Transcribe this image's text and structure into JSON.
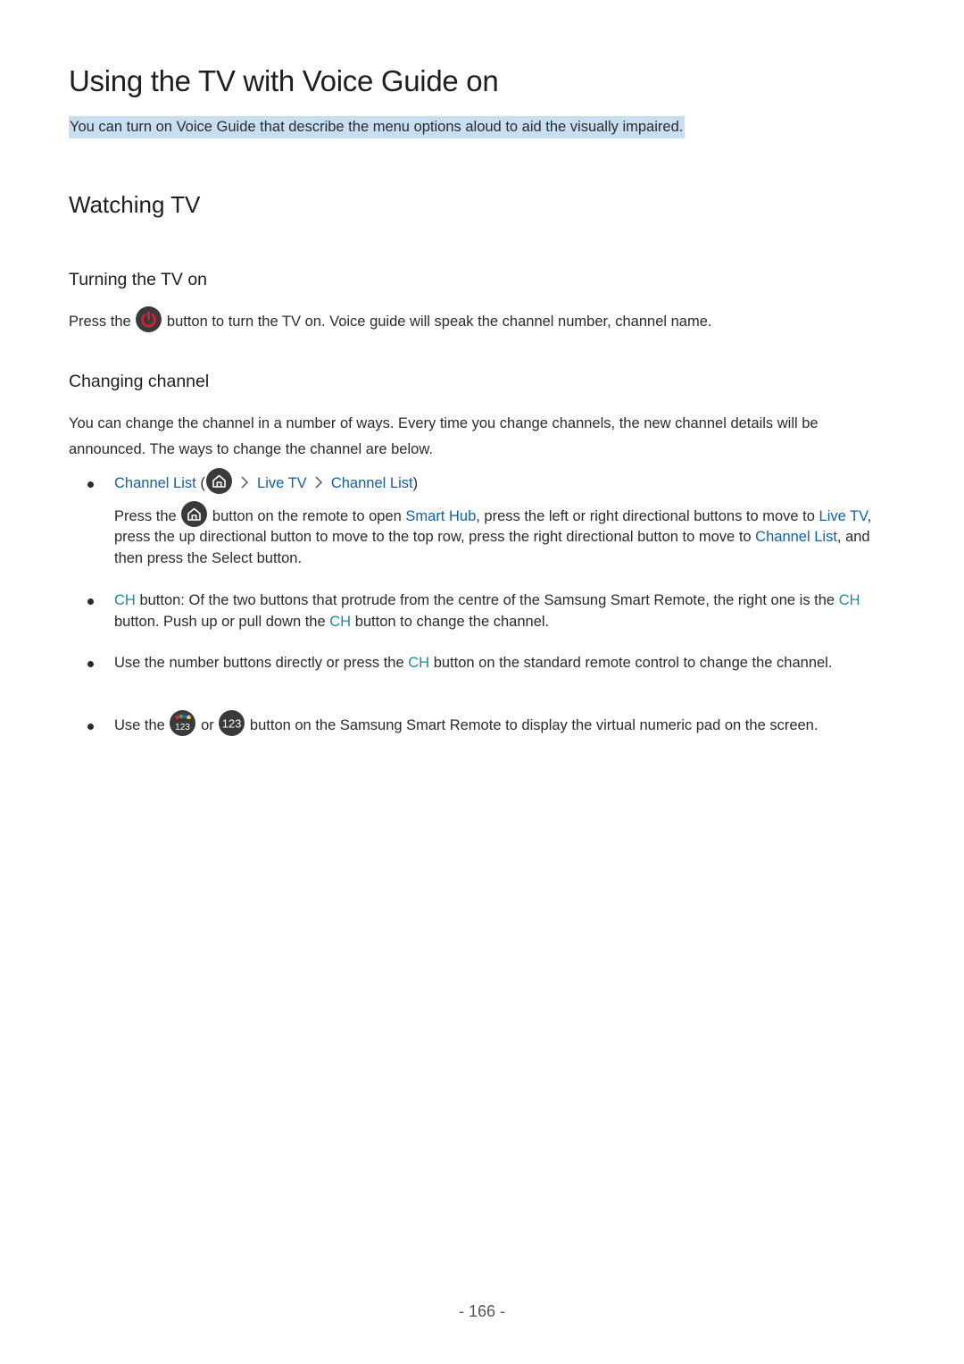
{
  "document": {
    "title": "Using the TV with Voice Guide on",
    "intro": "You can turn on Voice Guide that describe the menu options aloud to aid the visually impaired.",
    "section_heading": "Watching TV",
    "turning_on": {
      "heading": "Turning the TV on",
      "text_before_icon": "Press the",
      "icon": "power-icon",
      "text_after_icon": "button to turn the TV on. Voice guide will speak the channel number, channel name."
    },
    "changing_channel": {
      "heading": "Changing channel",
      "intro": "You can change the channel in a number of ways. Every time you change channels, the new channel details will be announced. The ways to change the channel are below.",
      "bullets": [
        {
          "menu_path": {
            "item1": "Channel List",
            "open_paren": "(",
            "icon": "home-icon",
            "item2": "Live TV",
            "item3": "Channel List",
            "close_paren": ")"
          },
          "body": {
            "t1": "Press the",
            "icon": "home-icon",
            "t2": "button on the remote to open",
            "link1": "Smart Hub",
            "t3": ", press the left or right directional buttons to move to",
            "link2": "Live TV",
            "t4": ", press the up directional button to move to the top row, press the right directional button to move to",
            "link3": "Channel List",
            "t5": ", and then press the Select button."
          }
        },
        {
          "ch1": "CH",
          "t1": "button: Of the two buttons that protrude from the centre of the Samsung Smart Remote, the right one is the",
          "ch2": "CH",
          "t2": "button. Push up or pull down the",
          "ch3": "CH",
          "t3": "button to change the channel."
        },
        {
          "t1": "Use the number buttons directly or press the",
          "ch1": "CH",
          "t2": "button on the standard remote control to change the channel."
        },
        {
          "t1": "Use the",
          "icon1": "color-123-icon",
          "t2": "or",
          "icon2": "123-icon",
          "t3": "button on the Samsung Smart Remote to display the virtual numeric pad on the screen.",
          "icon_label": "123"
        }
      ]
    },
    "page_number": "- 166 -"
  },
  "colors": {
    "menu_link": "#1160a8",
    "ch_key": "#1b8ba0",
    "highlight": "#c8dff2",
    "icon_bg": "#3a3a3a",
    "power_red": "#d8202e"
  }
}
